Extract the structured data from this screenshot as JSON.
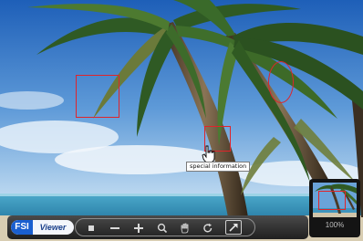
{
  "toolbar": {
    "logo": {
      "brand": "FSI",
      "product": "Viewer"
    },
    "buttons": [
      {
        "name": "reset",
        "icon": "square-icon"
      },
      {
        "name": "zoom-out",
        "icon": "minus-icon"
      },
      {
        "name": "zoom-in",
        "icon": "plus-icon"
      },
      {
        "name": "magnify",
        "icon": "magnifier-icon"
      },
      {
        "name": "pan",
        "icon": "hand-icon"
      },
      {
        "name": "rotate",
        "icon": "rotate-icon"
      },
      {
        "name": "fullscreen",
        "icon": "expand-arrow-icon"
      }
    ]
  },
  "tooltip": {
    "text": "special information"
  },
  "overview": {
    "zoom_level": "100%"
  },
  "colors": {
    "hotspot": "#e0242a",
    "toolbar": "#2b2b2b",
    "logo_blue": "#1a5fcf"
  }
}
